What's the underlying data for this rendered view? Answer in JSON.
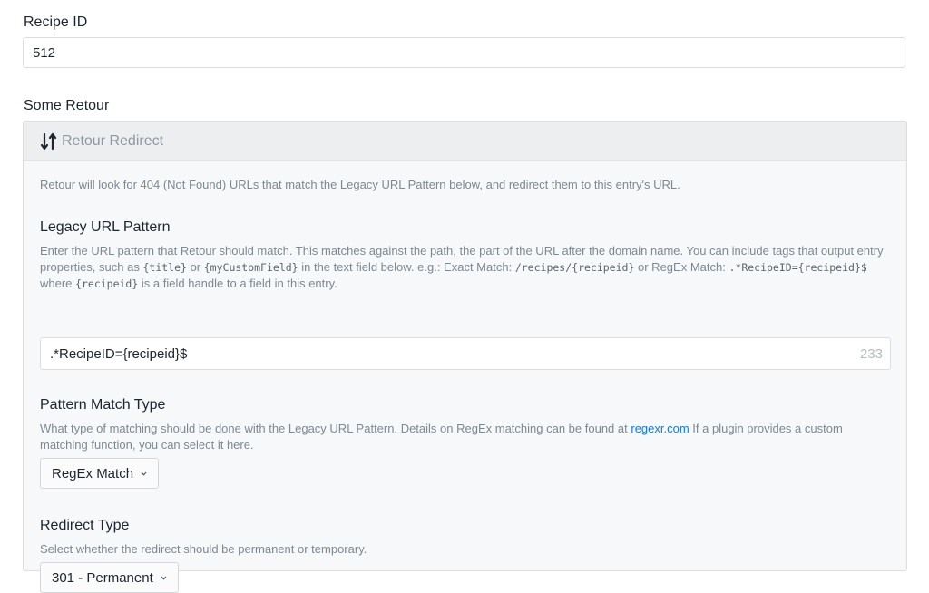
{
  "recipe": {
    "label": "Recipe ID",
    "value": "512"
  },
  "retour": {
    "label": "Some Retour",
    "pane_title": "Retour Redirect",
    "intro": "Retour will look for 404 (Not Found) URLs that match the Legacy URL Pattern below, and redirect them to this entry's URL.",
    "legacy": {
      "label": "Legacy URL Pattern",
      "help_1": "Enter the URL pattern that Retour should match. This matches against the path, the part of the URL after the domain name. You can include tags that output entry properties, such as",
      "code_title": "{title}",
      "help_or": "or",
      "code_custom": "{myCustomField}",
      "help_2": "in the text field below. e.g.: Exact Match:",
      "code_exact": "/recipes/{recipeid}",
      "help_3": "or RegEx Match:",
      "code_regex": ".*RecipeID={recipeid}$",
      "help_where": "where",
      "code_handle": "{recipeid}",
      "help_4": "is a field handle to a field in this entry.",
      "value": ".*RecipeID={recipeid}$",
      "char_count": "233"
    },
    "match_type": {
      "label": "Pattern Match Type",
      "help_1": "What type of matching should be done with the Legacy URL Pattern. Details on RegEx matching can be found at",
      "link": "regexr.com",
      "help_2": "If a plugin provides a custom matching function, you can select it here.",
      "selected": "RegEx Match"
    },
    "redirect_type": {
      "label": "Redirect Type",
      "help": "Select whether the redirect should be permanent or temporary.",
      "selected": "301 - Permanent"
    }
  }
}
